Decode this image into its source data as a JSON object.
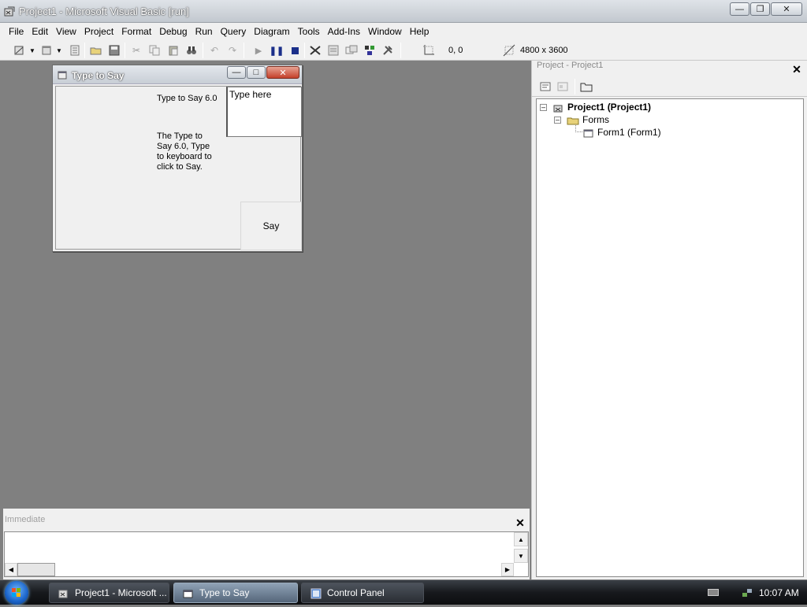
{
  "window": {
    "title": "Project1 - Microsoft Visual Basic [run]"
  },
  "menu": [
    "File",
    "Edit",
    "View",
    "Project",
    "Format",
    "Debug",
    "Run",
    "Query",
    "Diagram",
    "Tools",
    "Add-Ins",
    "Window",
    "Help"
  ],
  "toolbar": {
    "coords": "0, 0",
    "size": "4800 x 3600"
  },
  "form": {
    "title": "Type to Say",
    "label1": "Type to Say 6.0",
    "label2": "The Type to Say 6.0, Type to keyboard to click to Say.",
    "textbox": "Type here",
    "button": "Say"
  },
  "project": {
    "header": "Project - Project1",
    "root": "Project1 (Project1)",
    "folder": "Forms",
    "item": "Form1 (Form1)"
  },
  "immediate": {
    "header": "Immediate"
  },
  "taskbar": {
    "tasks": [
      "Project1 - Microsoft ...",
      "Type to Say",
      "Control Panel"
    ],
    "clock": "10:07 AM"
  },
  "colors": {
    "accent": "#1a63c8",
    "titlebar": "#cfd4da",
    "mdi_background": "#808080"
  }
}
